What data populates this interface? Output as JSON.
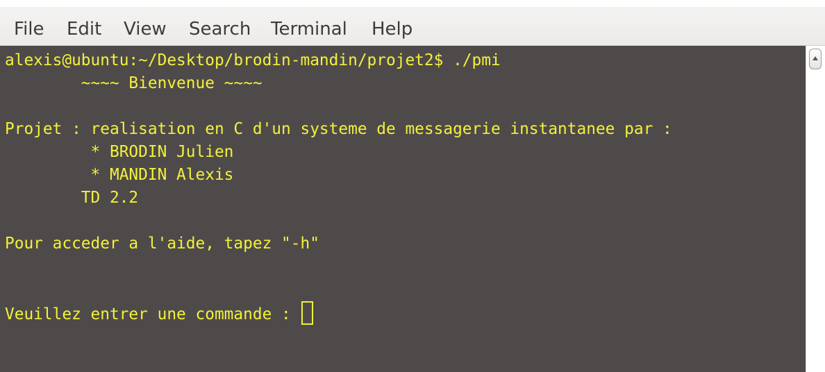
{
  "menubar": {
    "items": [
      "File",
      "Edit",
      "View",
      "Search",
      "Terminal",
      "Help"
    ]
  },
  "terminal": {
    "lines": [
      "alexis@ubuntu:~/Desktop/brodin-mandin/projet2$ ./pmi",
      "        ~~~~ Bienvenue ~~~~",
      "Projet : realisation en C d'un systeme de messagerie instantanee par :",
      "         * BRODIN Julien",
      "         * MANDIN Alexis",
      "        TD 2.2",
      "Pour acceder a l'aide, tapez \"-h\"",
      "Veuillez entrer une commande : "
    ],
    "text_color": "#f2f23a",
    "background_color": "#4f4a4a"
  },
  "scrollbar": {
    "up_icon": "arrow-up-icon"
  }
}
